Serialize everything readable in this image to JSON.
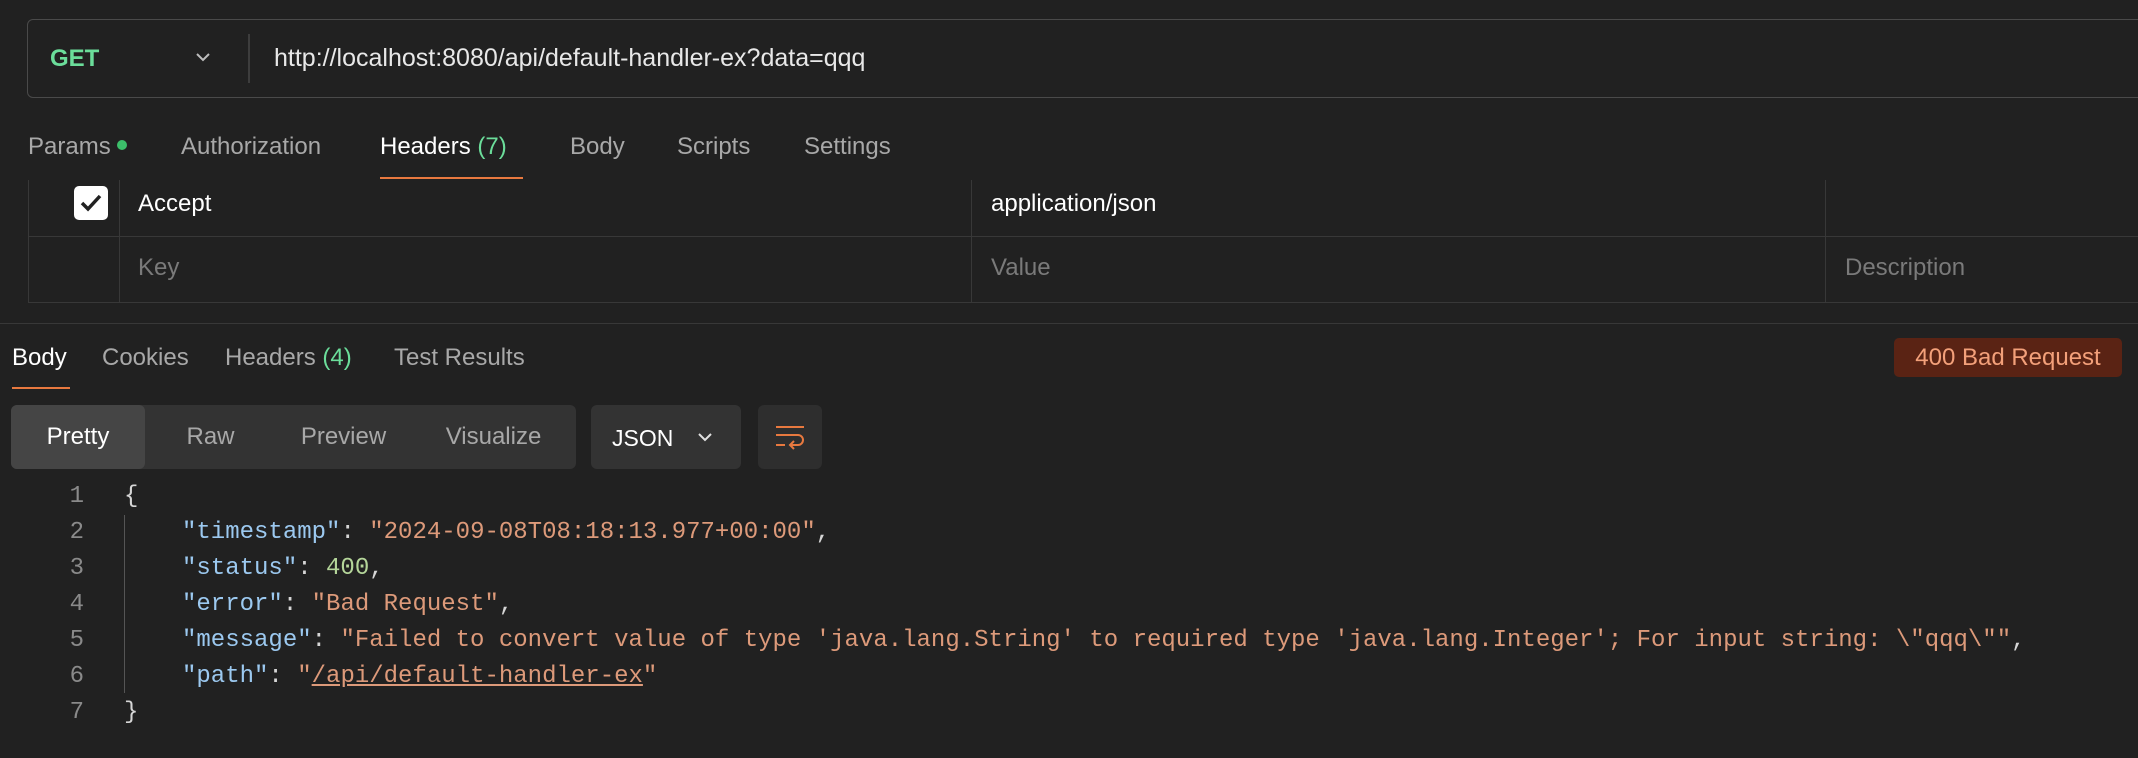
{
  "request": {
    "method": "GET",
    "url": "http://localhost:8080/api/default-handler-ex?data=qqq"
  },
  "request_tabs": {
    "params": "Params",
    "authorization": "Authorization",
    "headers": "Headers",
    "headers_count": "(7)",
    "body": "Body",
    "scripts": "Scripts",
    "settings": "Settings"
  },
  "headers_table": {
    "row": {
      "enabled": true,
      "key": "Accept",
      "value": "application/json"
    },
    "placeholders": {
      "key": "Key",
      "value": "Value",
      "description": "Description"
    }
  },
  "response_tabs": {
    "body": "Body",
    "cookies": "Cookies",
    "headers": "Headers",
    "headers_count": "(4)",
    "test_results": "Test Results"
  },
  "status": {
    "text": "400 Bad Request",
    "color": "#5a2314"
  },
  "format_toolbar": {
    "pretty": "Pretty",
    "raw": "Raw",
    "preview": "Preview",
    "visualize": "Visualize",
    "language": "JSON"
  },
  "response_body": {
    "line_numbers": [
      "1",
      "2",
      "3",
      "4",
      "5",
      "6",
      "7"
    ],
    "open_brace": "{",
    "close_brace": "}",
    "fields": {
      "timestamp_key": "\"timestamp\"",
      "timestamp_value": "\"2024-09-08T08:18:13.977+00:00\"",
      "status_key": "\"status\"",
      "status_value": "400",
      "error_key": "\"error\"",
      "error_value": "\"Bad Request\"",
      "message_key": "\"message\"",
      "message_value": "\"Failed to convert value of type 'java.lang.String' to required type 'java.lang.Integer'; For input string: \\\"qqq\\\"\"",
      "path_key": "\"path\"",
      "path_quote": "\"",
      "path_link": "/api/default-handler-ex"
    }
  },
  "colors": {
    "accent": "#e8793f",
    "method": "#6bdd9a",
    "json_key": "#9cc9f0",
    "json_string": "#dd9a7a",
    "json_number": "#b5d69a"
  },
  "icons": [
    "chevron-down-icon",
    "checkmark-icon",
    "wrap-lines-icon"
  ]
}
